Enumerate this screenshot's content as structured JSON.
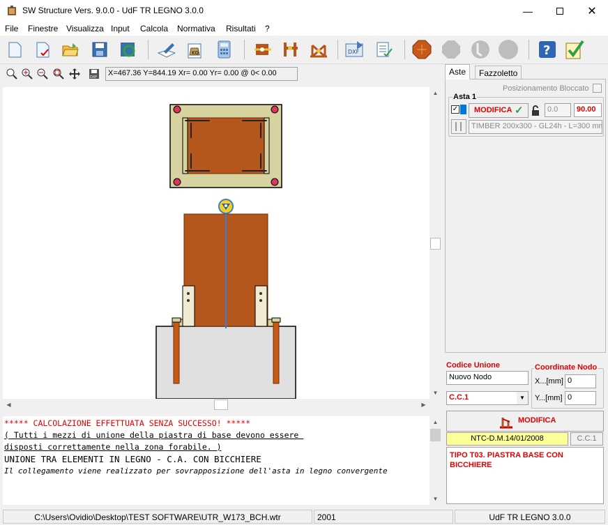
{
  "window": {
    "title": "SW Structure Vers. 9.0.0 - UdF TR LEGNO 3.0.0"
  },
  "menu": [
    "File",
    "Finestre",
    "Visualizza",
    "Input",
    "Calcola",
    "Normativa",
    "Risultati",
    "?"
  ],
  "coords": "X=467.36 Y=844.19 Xr= 0.00 Yr= 0.00 @  0< 0.00",
  "tabs": {
    "aste": "Aste",
    "fazzoletto": "Fazzoletto"
  },
  "panel": {
    "lock_label": "Posizionamento Bloccato",
    "asta_title": "Asta 1",
    "modify_label": "MODIFICA",
    "angle1": "0.0",
    "angle2": "90.00",
    "section": "TIMBER 200x300 - GL24h - L=300 mm"
  },
  "node": {
    "codice_label": "Codice Unione",
    "codice_value": "Nuovo Nodo",
    "coord_title": "Coordinate Nodo",
    "x_label": "X...[mm]",
    "x_value": "0",
    "y_label": "Y...[mm]",
    "y_value": "0",
    "combo_value": "C.C.1",
    "modify_label": "MODIFICA",
    "norma": "NTC-D.M.14/01/2008",
    "cc": "C.C.1",
    "tipo": "TIPO T03. PIASTRA BASE CON BICCHIERE"
  },
  "console": {
    "lines": [
      {
        "text": "***** CALCOLAZIONE EFFETTUATA SENZA SUCCESSO! *****",
        "style": "error"
      },
      {
        "text": "( Tutti i mezzi di unione della piastra di base devono essere ",
        "style": "ul"
      },
      {
        "text": "disposti correttamente nella zona forabile. )",
        "style": "ul"
      },
      {
        "text": "",
        "style": "plain"
      },
      {
        "text": "UNIONE TRA ELEMENTI IN LEGNO - C.A. CON BICCHIERE",
        "style": "plain"
      },
      {
        "text": "",
        "style": "plain"
      },
      {
        "text": "Il collegamento viene realizzato per sovrapposizione dell'asta in legno convergente",
        "style": "italic"
      }
    ]
  },
  "status": {
    "path": "C:\\Users\\Ovidio\\Desktop\\TEST SOFTWARE\\UTR_W173_BCH.wtr",
    "code": "2001",
    "app": "UdF TR LEGNO 3.0.0"
  },
  "colors": {
    "wood": "#b5561c",
    "plate": "#d6d3a0",
    "error": "#e00000",
    "accent": "#0078d7"
  }
}
